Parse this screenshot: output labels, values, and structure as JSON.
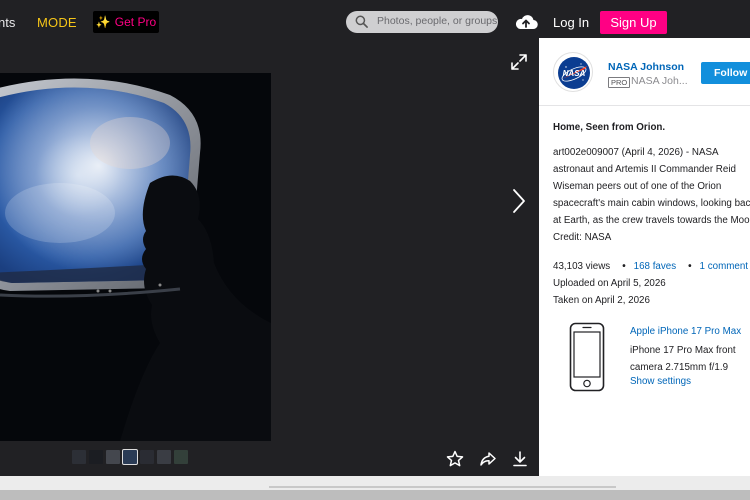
{
  "header": {
    "nav_partial": "nts",
    "mode_label": "MODE",
    "get_pro_label": "Get Pro",
    "search_placeholder": "Photos, people, or groups",
    "login_label": "Log In",
    "signup_label": "Sign Up"
  },
  "owner": {
    "name": "NASA Johnson",
    "pro_badge": "PRO",
    "handle": "NASA Joh...",
    "follow_label": "Follow",
    "avatar_text": "NASA"
  },
  "photo": {
    "title": "Home, Seen from Orion.",
    "description_lines": [
      "art002e009007 (April 4, 2026) - NASA",
      "astronaut and Artemis II Commander Reid",
      "Wiseman peers out of one of the Orion",
      "spacecraft's main cabin windows, looking back",
      "at Earth, as the crew travels towards the Moon.",
      "Credit: NASA"
    ],
    "views": "43,103 views",
    "faves": "168 faves",
    "comments": "1 comment",
    "uploaded": "Uploaded on April 5, 2026",
    "taken": "Taken on April 2, 2026"
  },
  "camera": {
    "model": "Apple iPhone 17 Pro Max",
    "lens_lines": [
      "iPhone 17 Pro Max front",
      "camera 2.715mm f/1.9"
    ],
    "settings_label": "Show settings"
  },
  "icons": {
    "search": "search-icon",
    "upload": "cloud-upload-icon",
    "expand": "expand-icon",
    "next": "chevron-right-icon",
    "fave": "star-icon",
    "share": "share-icon",
    "download": "download-icon",
    "camera": "phone-icon"
  },
  "colors": {
    "accent_pink": "#ff0084",
    "link_blue": "#0066b8",
    "follow_blue": "#128fdc",
    "mode_yellow": "#f5c518",
    "dark_bg": "#212124"
  }
}
